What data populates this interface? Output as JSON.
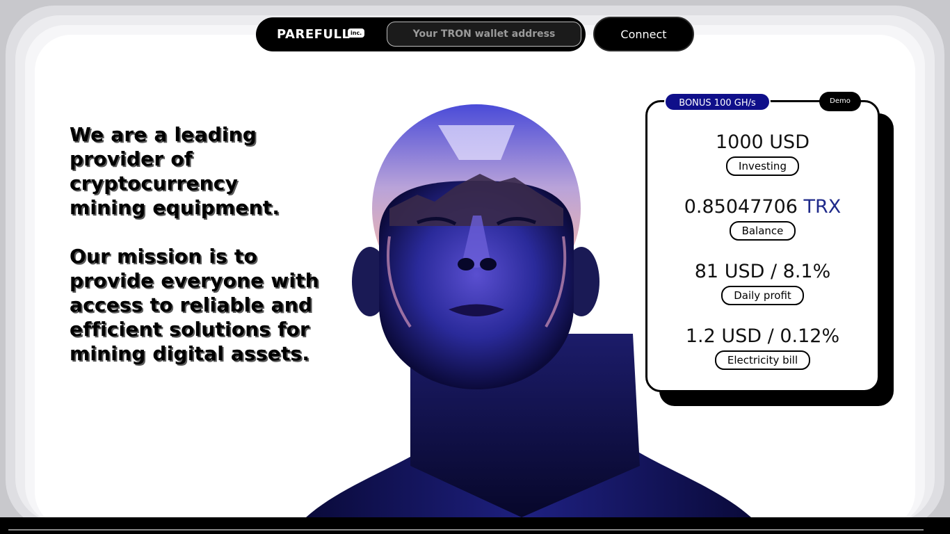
{
  "header": {
    "brand": "PAREFULL",
    "brand_badge": "inc.",
    "wallet_placeholder": "Your TRON wallet address",
    "connect_label": "Connect"
  },
  "hero": {
    "paragraph1": "We are a leading provider of cryptocurrency mining equipment.",
    "paragraph2": "Our mission is to provide everyone with access to reliable and efficient solutions for mining digital assets."
  },
  "card": {
    "bonus": "BONUS 100 GH/s",
    "demo": "Demo",
    "stats": [
      {
        "value": "1000 USD",
        "unit": "",
        "label": "Investing"
      },
      {
        "value": "0.85047706 ",
        "unit": "TRX",
        "label": "Balance"
      },
      {
        "value": "81 USD / 8.1%",
        "unit": "",
        "label": "Daily profit"
      },
      {
        "value": "1.2 USD / 0.12%",
        "unit": "",
        "label": "Electricity bill"
      }
    ]
  },
  "colors": {
    "accent": "#0f0f8a",
    "unit": "#1f2a8a",
    "background": "#ffffff"
  },
  "icons": {
    "hero_image": "chrome-head-portrait"
  }
}
